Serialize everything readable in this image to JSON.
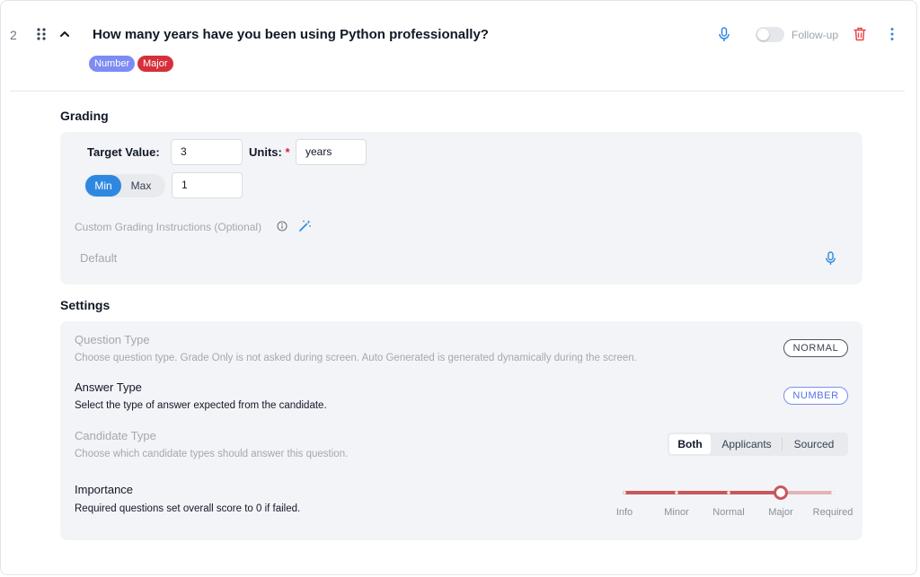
{
  "question": {
    "number": "2",
    "title": "How many years have you been using Python professionally?",
    "badges": [
      "Number",
      "Major"
    ],
    "followup_label": "Follow-up",
    "followup_enabled": false
  },
  "grading": {
    "section_title": "Grading",
    "target_value_label": "Target Value:",
    "target_value": "3",
    "units_label": "Units:",
    "units_required_mark": "*",
    "units_value": "years",
    "min_label": "Min",
    "max_label": "Max",
    "min_max_selected": "Min",
    "threshold_value": "1",
    "custom_instructions_label": "Custom Grading Instructions (Optional)",
    "custom_instructions_placeholder": "Default"
  },
  "settings": {
    "section_title": "Settings",
    "question_type": {
      "title": "Question Type",
      "description": "Choose question type. Grade Only is not asked during screen. Auto Generated is generated dynamically during the screen.",
      "value": "NORMAL"
    },
    "answer_type": {
      "title": "Answer Type",
      "description": "Select the type of answer expected from the candidate.",
      "value": "NUMBER"
    },
    "candidate_type": {
      "title": "Candidate Type",
      "description": "Choose which candidate types should answer this question.",
      "options": [
        "Both",
        "Applicants",
        "Sourced"
      ],
      "selected": "Both"
    },
    "importance": {
      "title": "Importance",
      "description": "Required questions set overall score to 0 if failed.",
      "levels": [
        "Info",
        "Minor",
        "Normal",
        "Major",
        "Required"
      ],
      "selected_index": 3
    }
  },
  "colors": {
    "accent_blue": "#2f88e0",
    "badge_number": "#7c8cf4",
    "badge_major": "#d6303b",
    "slider_active": "#c8575c",
    "slider_inactive": "#e6b3b5",
    "trash": "#ef4444"
  },
  "icons": [
    "drag-handle-icon",
    "chevron-up-icon",
    "microphone-icon",
    "trash-icon",
    "more-vertical-icon",
    "info-icon",
    "magic-wand-icon"
  ]
}
